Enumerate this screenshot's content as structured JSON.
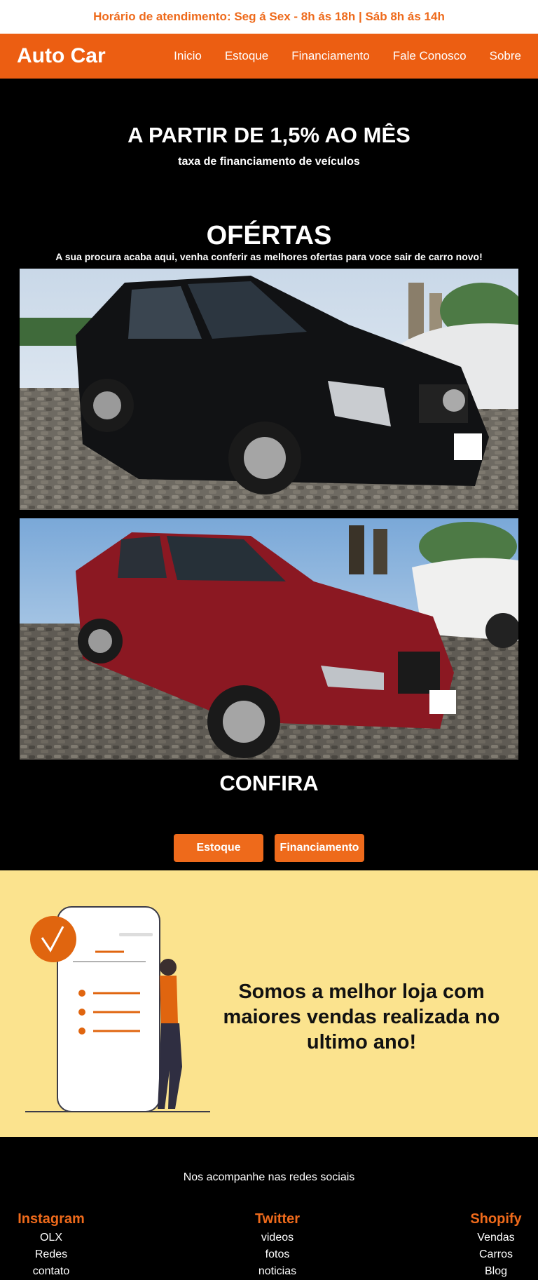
{
  "topbar": {
    "hours": "Horário de atendimento: Seg á Sex - 8h ás 18h | Sáb 8h ás 14h"
  },
  "navbar": {
    "brand": "Auto Car",
    "links": [
      "Inicio",
      "Estoque",
      "Financiamento",
      "Fale Conosco",
      "Sobre"
    ]
  },
  "hero": {
    "title": "A PARTIR DE 1,5% AO MÊS",
    "subtitle": "taxa de financiamento de veículos"
  },
  "offers": {
    "title": "OFÉRTAS",
    "subtitle": "A sua procura acaba aqui, venha conferir as melhores ofertas para voce sair de carro novo!"
  },
  "confira": {
    "title": "CONFIRA",
    "buttons": [
      "Estoque",
      "Financiamento"
    ]
  },
  "promo": {
    "text": "Somos a melhor loja com maiores vendas realizada no ultimo ano!"
  },
  "footer": {
    "subtitle": "Nos acompanhe nas redes sociais",
    "columns": [
      {
        "title": "Instagram",
        "links": [
          "OLX",
          "Redes",
          "contato"
        ]
      },
      {
        "title": "Twitter",
        "links": [
          "videos",
          "fotos",
          "noticias"
        ]
      },
      {
        "title": "Shopify",
        "links": [
          "Vendas",
          "Carros",
          "Blog"
        ]
      }
    ]
  },
  "colors": {
    "accent": "#ec5e12",
    "promo_bg": "#fbe38e",
    "page_bg": "#000000"
  },
  "icons": {
    "promo_check": "check-circle-icon"
  }
}
